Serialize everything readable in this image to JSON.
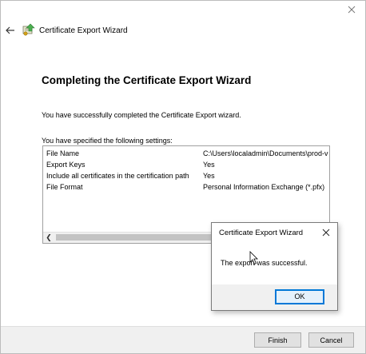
{
  "window": {
    "title": "Certificate Export Wizard",
    "heading": "Completing the Certificate Export Wizard",
    "success_text": "You have successfully completed the Certificate Export wizard.",
    "settings_label": "You have specified the following settings:"
  },
  "settings": [
    {
      "key": "File Name",
      "value": "C:\\Users\\localadmin\\Documents\\prod-v"
    },
    {
      "key": "Export Keys",
      "value": "Yes"
    },
    {
      "key": "Include all certificates in the certification path",
      "value": "Yes"
    },
    {
      "key": "File Format",
      "value": "Personal Information Exchange (*.pfx)"
    }
  ],
  "buttons": {
    "finish": "Finish",
    "cancel": "Cancel"
  },
  "message_box": {
    "title": "Certificate Export Wizard",
    "text": "The export was successful.",
    "ok": "OK"
  },
  "colors": {
    "accent": "#0078d7",
    "footer_bg": "#f0f0f0"
  },
  "icons": [
    "close-icon",
    "back-arrow-icon",
    "certificate-icon",
    "scroll-left-icon",
    "mouse-cursor-icon"
  ]
}
